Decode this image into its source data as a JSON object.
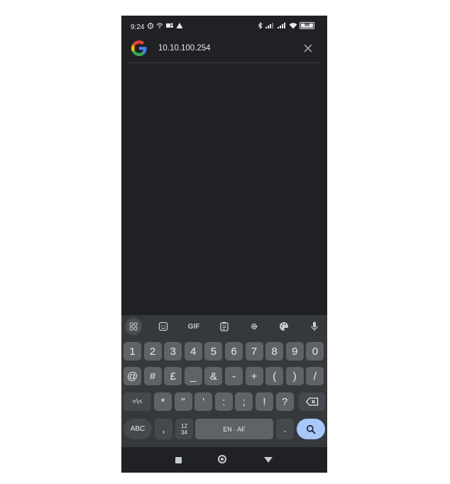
{
  "status_bar": {
    "time": "9:24",
    "battery": "99"
  },
  "search": {
    "query": "10.10.100.254"
  },
  "keyboard": {
    "toolbar": {
      "gif_label": "GIF"
    },
    "number_row": [
      "1",
      "2",
      "3",
      "4",
      "5",
      "6",
      "7",
      "8",
      "9",
      "0"
    ],
    "symbol_row_1": [
      "@",
      "#",
      "£",
      "_",
      "&",
      "-",
      "+",
      "(",
      ")",
      "/"
    ],
    "symbol_row_2": {
      "shift_label": "=\\<",
      "keys": [
        "*",
        "\"",
        "'",
        ":",
        ";",
        "!",
        "?"
      ]
    },
    "bottom_row": {
      "abc_label": "ABC",
      "comma": ",",
      "numpad_top": "12",
      "numpad_bottom": "34",
      "space_label": "EN · AF",
      "period": "."
    }
  },
  "colors": {
    "background": "#202124",
    "keyboard": "#36393c",
    "key": "#5f6368",
    "accent_search_key": "#a8c7fa"
  }
}
